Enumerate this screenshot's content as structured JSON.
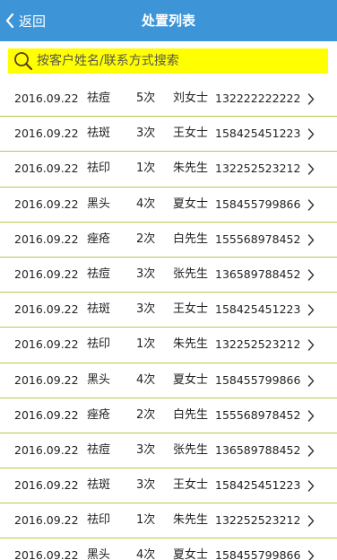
{
  "header": {
    "back_label": "返回",
    "title": "处置列表",
    "back_icon": "chevron-left-icon",
    "background": "#3d95d8"
  },
  "search": {
    "placeholder": "按客户姓名/联系方式搜索",
    "value": "",
    "icon": "search-icon",
    "background": "#ffff00"
  },
  "list": {
    "row_icon": "chevron-right-icon",
    "divider_color": "#b5c94a",
    "rows": [
      {
        "date": "2016.09.22",
        "service": "祛痘",
        "count": "5次",
        "name": "刘女士",
        "phone": "132222222222"
      },
      {
        "date": "2016.09.22",
        "service": "祛斑",
        "count": "3次",
        "name": "王女士",
        "phone": "158425451223"
      },
      {
        "date": "2016.09.22",
        "service": "祛印",
        "count": "1次",
        "name": "朱先生",
        "phone": "132252523212"
      },
      {
        "date": "2016.09.22",
        "service": "黑头",
        "count": "4次",
        "name": "夏女士",
        "phone": "158455799866"
      },
      {
        "date": "2016.09.22",
        "service": "痤疮",
        "count": "2次",
        "name": "白先生",
        "phone": "155568978452"
      },
      {
        "date": "2016.09.22",
        "service": "祛痘",
        "count": "3次",
        "name": "张先生",
        "phone": "136589788452"
      },
      {
        "date": "2016.09.22",
        "service": "祛斑",
        "count": "3次",
        "name": "王女士",
        "phone": "158425451223"
      },
      {
        "date": "2016.09.22",
        "service": "祛印",
        "count": "1次",
        "name": "朱先生",
        "phone": "132252523212"
      },
      {
        "date": "2016.09.22",
        "service": "黑头",
        "count": "4次",
        "name": "夏女士",
        "phone": "158455799866"
      },
      {
        "date": "2016.09.22",
        "service": "痤疮",
        "count": "2次",
        "name": "白先生",
        "phone": "155568978452"
      },
      {
        "date": "2016.09.22",
        "service": "祛痘",
        "count": "3次",
        "name": "张先生",
        "phone": "136589788452"
      },
      {
        "date": "2016.09.22",
        "service": "祛斑",
        "count": "3次",
        "name": "王女士",
        "phone": "158425451223"
      },
      {
        "date": "2016.09.22",
        "service": "祛印",
        "count": "1次",
        "name": "朱先生",
        "phone": "132252523212"
      },
      {
        "date": "2016.09.22",
        "service": "黑头",
        "count": "4次",
        "name": "夏女士",
        "phone": "158455799866"
      }
    ]
  }
}
